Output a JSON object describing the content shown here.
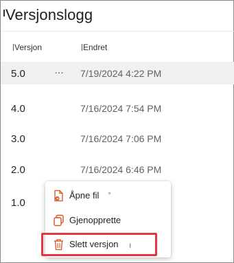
{
  "panel": {
    "title": "Versjonslogg"
  },
  "columns": {
    "version": "Versjon",
    "changed": "Endret"
  },
  "rows": [
    {
      "version": "5.0",
      "changed": "7/19/2024 4:22 PM",
      "selected": true,
      "more": "..."
    },
    {
      "version": "4.0",
      "changed": "7/16/2024 7:54 PM"
    },
    {
      "version": "3.0",
      "changed": "7/16/2024 7:06 PM"
    },
    {
      "version": "2.0",
      "changed": "7/16/2024 6:46 PM"
    },
    {
      "version": "1.0",
      "changed": ""
    }
  ],
  "context_menu": {
    "items": [
      {
        "label": "Åpne fil",
        "icon": "open-file-icon"
      },
      {
        "label": "Gjenopprette",
        "icon": "restore-icon"
      },
      {
        "label": "Slett versjon",
        "icon": "trash-icon",
        "highlighted": true
      }
    ]
  },
  "colors": {
    "accent_orange": "#d9531e",
    "highlight_red": "#e0383e",
    "selected_row": "#f0f0f0"
  }
}
